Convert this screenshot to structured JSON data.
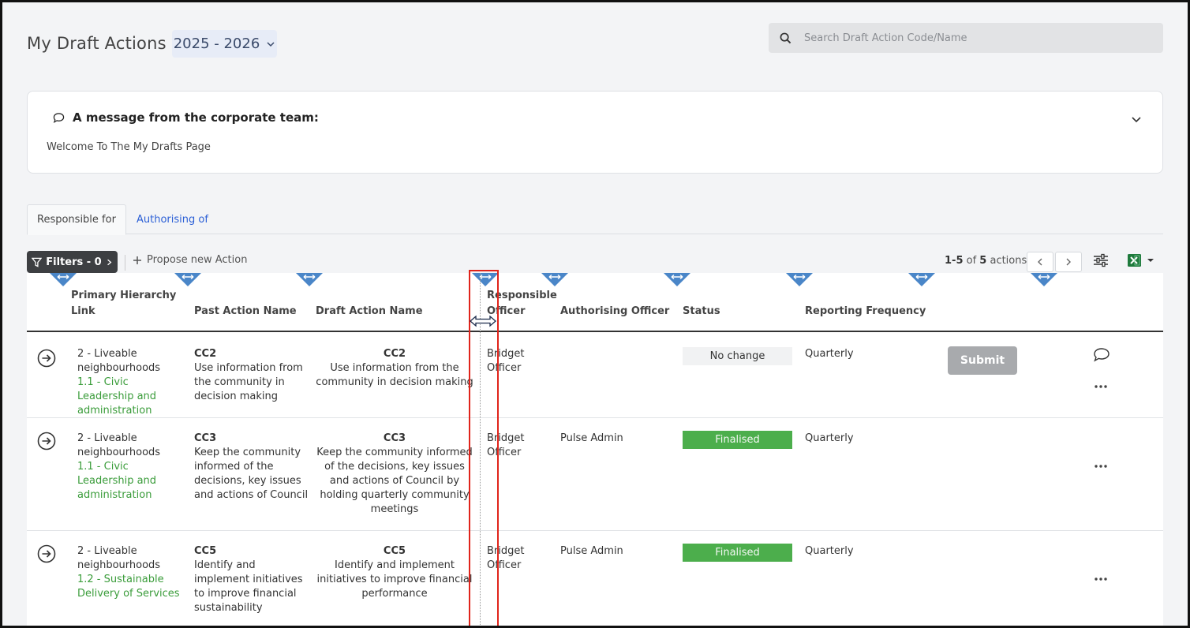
{
  "header": {
    "title": "My Draft Actions",
    "year": "2025 - 2026",
    "search_placeholder": "Search Draft Action Code/Name"
  },
  "message": {
    "title": "A message from the corporate team:",
    "body": "Welcome To The My Drafts Page"
  },
  "tabs": [
    {
      "label": "Responsible for",
      "active": true
    },
    {
      "label": "Authorising of",
      "active": false
    }
  ],
  "toolbar": {
    "filters_label": "Filters - 0",
    "propose_label": "Propose new Action",
    "range": "1-5",
    "of_text": " of ",
    "total": "5",
    "actions_text": " actions"
  },
  "table": {
    "columns": {
      "primary_l1": "Primary Hierarchy",
      "primary_l2": "Link",
      "past": "Past Action Name",
      "draft": "Draft Action Name",
      "resp_l1": "Responsible",
      "resp_l2": "Officer",
      "auth": "Authorising Officer",
      "status": "Status",
      "freq": "Reporting Frequency"
    },
    "submit_label": "Submit",
    "rows": [
      {
        "hierarchy": "2 - Liveable neighbourhoods",
        "sub": "1.1 - Civic Leadership and administration",
        "past_code": "CC2",
        "past_name": "Use information from the community in decision making",
        "draft_code": "CC2",
        "draft_name": "Use information from the community in decision making",
        "responsible": "Bridget Officer",
        "authorising": "",
        "status": "No change",
        "frequency": "Quarterly"
      },
      {
        "hierarchy": "2 - Liveable neighbourhoods",
        "sub": "1.1 - Civic Leadership and administration",
        "past_code": "CC3",
        "past_name": "Keep the community informed of the decisions, key issues and actions of Council",
        "draft_code": "CC3",
        "draft_name": "Keep the community informed of the decisions, key issues and actions of Council by holding quarterly community meetings",
        "responsible": "Bridget Officer",
        "authorising": "Pulse Admin",
        "status": "Finalised",
        "frequency": "Quarterly"
      },
      {
        "hierarchy": "2 - Liveable neighbourhoods",
        "sub": "1.2 - Sustainable Delivery of Services",
        "past_code": "CC5",
        "past_name": "Identify and implement initiatives to improve financial sustainability",
        "draft_code": "CC5",
        "draft_name": "Identify and implement initiatives to improve financial performance",
        "responsible": "Bridget Officer",
        "authorising": "Pulse Admin",
        "status": "Finalised",
        "frequency": "Quarterly"
      }
    ]
  },
  "colors": {
    "accent_blue": "#4a86c8",
    "finalised_green": "#4cae4c",
    "link_green": "#3a9c3a",
    "highlight_red": "#e0241b"
  },
  "icons": {
    "search": "search-icon",
    "message": "speech-bubble-icon",
    "chevron": "chevron-down-icon",
    "filter": "funnel-icon",
    "add": "plus-icon",
    "settings": "sliders-icon",
    "export": "excel-icon",
    "open": "arrow-circle-right-icon",
    "comment": "comment-icon",
    "more": "ellipsis-icon",
    "resize": "double-arrow-icon"
  }
}
